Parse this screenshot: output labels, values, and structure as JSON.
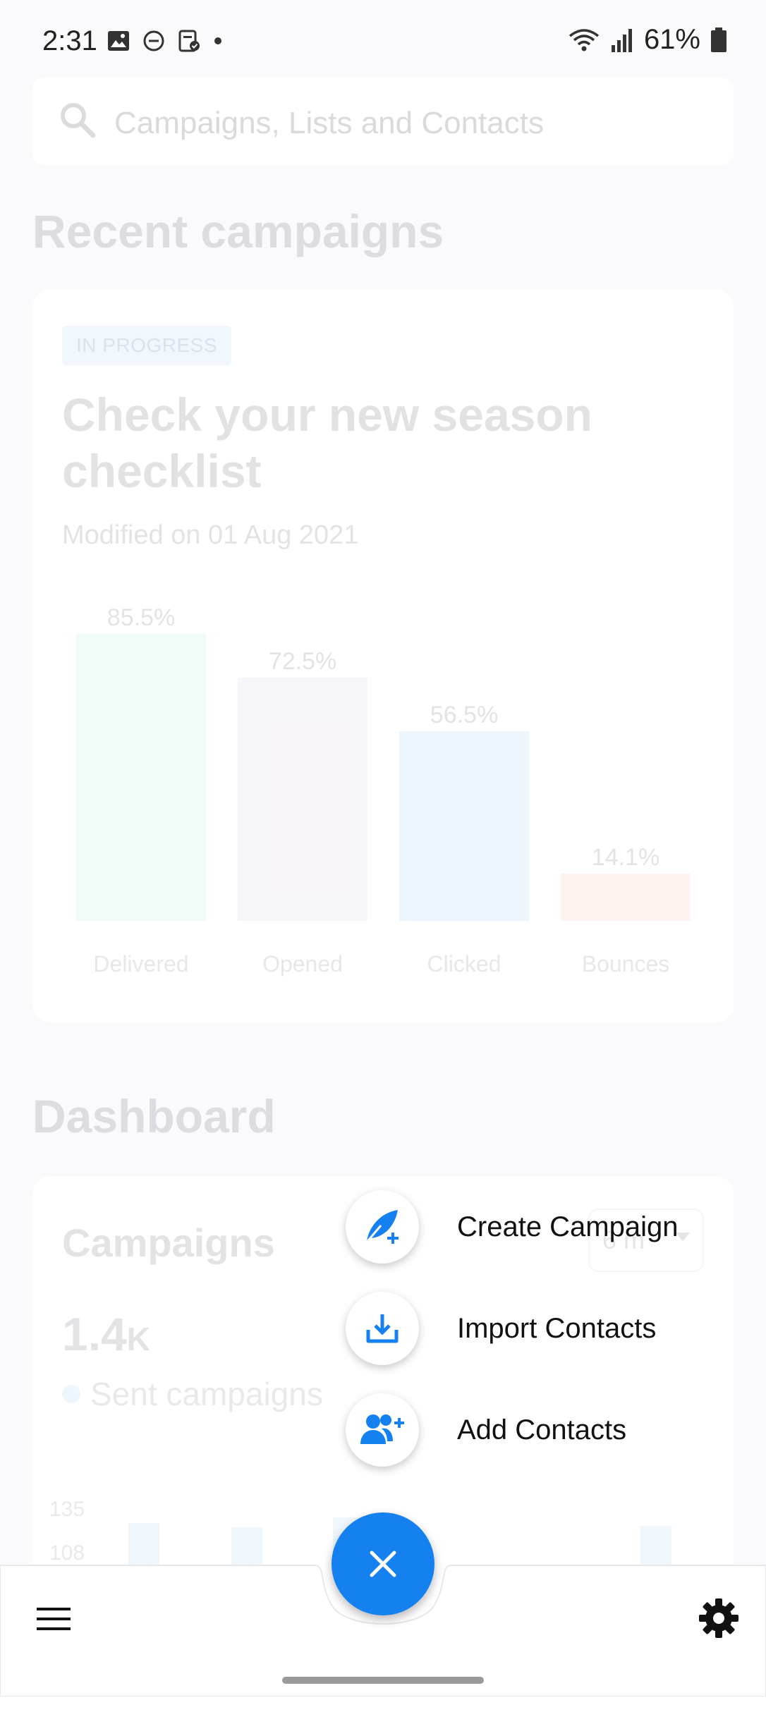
{
  "status_bar": {
    "time": "2:31",
    "battery": "61%"
  },
  "search": {
    "placeholder": "Campaigns, Lists and Contacts"
  },
  "recent": {
    "heading": "Recent campaigns",
    "card": {
      "badge": "IN PROGRESS",
      "title": "Check your new season checklist",
      "modified": "Modified on 01 Aug 2021"
    }
  },
  "chart_data": {
    "type": "bar",
    "categories": [
      "Delivered",
      "Opened",
      "Clicked",
      "Bounces"
    ],
    "values": [
      85.5,
      72.5,
      56.5,
      14.1
    ],
    "labels": [
      "85.5%",
      "72.5%",
      "56.5%",
      "14.1%"
    ],
    "colors": [
      "#eafbf5",
      "#f2f0f8",
      "#e3f2fc",
      "#fdebea"
    ],
    "ylim": [
      0,
      100
    ]
  },
  "dashboard": {
    "heading": "Dashboard",
    "card": {
      "title": "Campaigns",
      "period": "6 m",
      "value": "1.4",
      "value_suffix": "K",
      "legend": "Sent campaigns",
      "y_ticks": [
        "135",
        "108"
      ]
    }
  },
  "actions": [
    {
      "label": "Create Campaign",
      "icon": "feather-plus-icon"
    },
    {
      "label": "Import Contacts",
      "icon": "download-tray-icon"
    },
    {
      "label": "Add Contacts",
      "icon": "add-users-icon"
    }
  ],
  "colors": {
    "accent": "#1581f0"
  }
}
